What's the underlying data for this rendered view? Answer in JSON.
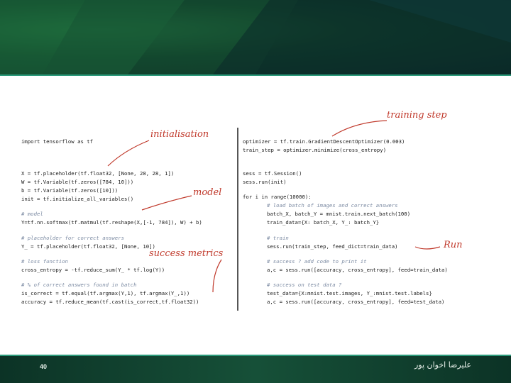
{
  "annotations": {
    "initialisation": "initialisation",
    "training_step": "training step",
    "model": "model",
    "success_metrics": "success metrics",
    "run": "Run"
  },
  "code_left": [
    "import tensorflow as tf",
    "",
    "",
    "X = tf.placeholder(tf.float32, [None, 28, 28, 1])",
    "W = tf.Variable(tf.zeros([784, 10]))",
    "b = tf.Variable(tf.zeros([10]))",
    "init = tf.initialize_all_variables()",
    "",
    "# model",
    "Y=tf.nn.softmax(tf.matmul(tf.reshape(X,[-1, 784]), W) + b)",
    "",
    "# placeholder for correct answers",
    "Y_ = tf.placeholder(tf.float32, [None, 10])",
    "",
    "# loss function",
    "cross_entropy = -tf.reduce_sum(Y_ * tf.log(Y))",
    "",
    "# % of correct answers found in batch",
    "is_correct = tf.equal(tf.argmax(Y,1), tf.argmax(Y_,1))",
    "accuracy = tf.reduce_mean(tf.cast(is_correct,tf.float32))"
  ],
  "code_right": [
    "optimizer = tf.train.GradientDescentOptimizer(0.003)",
    "train_step = optimizer.minimize(cross_entropy)",
    "",
    "",
    "sess = tf.Session()",
    "sess.run(init)",
    "",
    "for i in range(10000):",
    "# load batch of images and correct answers",
    "batch_X, batch_Y = mnist.train.next_batch(100)",
    "train_data={X: batch_X, Y_: batch_Y}",
    "",
    "# train",
    "sess.run(train_step, feed_dict=train_data)",
    "",
    "# success ? add code to print it",
    "a,c = sess.run([accuracy, cross_entropy], feed=train_data)",
    "",
    "# success on test data ?",
    "test_data={X:mnist.test.images, Y_:mnist.test.labels}",
    "a,c = sess.run([accuracy, cross_entropy], feed=test_data)"
  ],
  "footer": {
    "page_number": "40",
    "author": "علیرضا اخوان پور"
  },
  "colors": {
    "banner": "#10402a",
    "footer": "#165038",
    "accent_line": "#2b9a7a",
    "annotation": "#c0392b",
    "comment": "#7b8aa2"
  }
}
